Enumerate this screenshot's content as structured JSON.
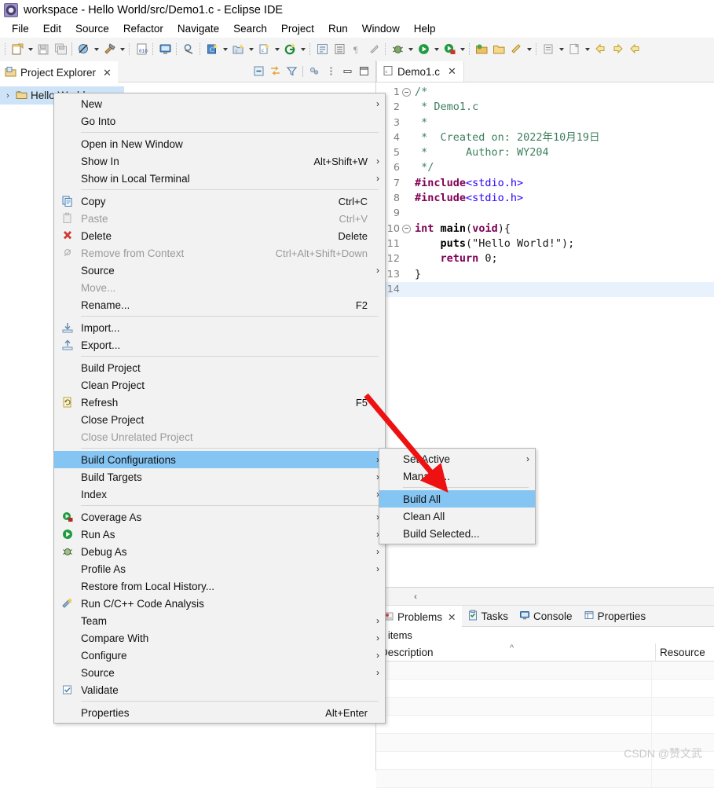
{
  "window": {
    "title": "workspace - Hello World/src/Demo1.c - Eclipse IDE",
    "app_icon": "eclipse-icon"
  },
  "menubar": {
    "items": [
      "File",
      "Edit",
      "Source",
      "Refactor",
      "Navigate",
      "Search",
      "Project",
      "Run",
      "Window",
      "Help"
    ]
  },
  "explorer": {
    "tab_label": "Project Explorer",
    "close_label": "✕",
    "tree": [
      {
        "label": "Hello World",
        "twisty": "›",
        "selected": true
      }
    ]
  },
  "editor": {
    "tab_label": "Demo1.c",
    "close_label": "✕",
    "lines": [
      {
        "n": "1",
        "fold": true,
        "text": "/*"
      },
      {
        "n": "2",
        "fold": false,
        "text": " * Demo1.c"
      },
      {
        "n": "3",
        "fold": false,
        "text": " *"
      },
      {
        "n": "4",
        "fold": false,
        "text": " *  Created on: 2022年10月19日"
      },
      {
        "n": "5",
        "fold": false,
        "text": " *      Author: WY204"
      },
      {
        "n": "6",
        "fold": false,
        "text": " */"
      },
      {
        "n": "7",
        "fold": false,
        "text": "#include<stdio.h>"
      },
      {
        "n": "8",
        "fold": false,
        "text": "#include<stdio.h>"
      },
      {
        "n": "9",
        "fold": false,
        "text": ""
      },
      {
        "n": "10",
        "fold": true,
        "text": "int main(void){"
      },
      {
        "n": "11",
        "fold": false,
        "text": "    puts(\"Hello World!\");"
      },
      {
        "n": "12",
        "fold": false,
        "text": "    return 0;"
      },
      {
        "n": "13",
        "fold": false,
        "text": "}"
      },
      {
        "n": "14",
        "fold": false,
        "text": ""
      }
    ]
  },
  "bottom_view": {
    "tabs": [
      {
        "label": "Problems",
        "icon": "problems-icon",
        "active": true,
        "closable": true
      },
      {
        "label": "Tasks",
        "icon": "tasks-icon",
        "active": false,
        "closable": false
      },
      {
        "label": "Console",
        "icon": "console-icon",
        "active": false,
        "closable": false
      },
      {
        "label": "Properties",
        "icon": "properties-icon",
        "active": false,
        "closable": false
      }
    ],
    "item_count": "0 items",
    "columns": [
      "Description",
      "Resource"
    ]
  },
  "context_menu": {
    "items": [
      {
        "label": "New",
        "icon": "",
        "accel": "",
        "arrow": true,
        "disabled": false,
        "highlight": false
      },
      {
        "label": "Go Into",
        "icon": "",
        "accel": "",
        "arrow": false,
        "disabled": false,
        "highlight": false
      },
      {
        "separator": true
      },
      {
        "label": "Open in New Window",
        "icon": "",
        "accel": "",
        "arrow": false,
        "disabled": false,
        "highlight": false
      },
      {
        "label": "Show In",
        "icon": "",
        "accel": "Alt+Shift+W",
        "arrow": true,
        "disabled": false,
        "highlight": false
      },
      {
        "label": "Show in Local Terminal",
        "icon": "",
        "accel": "",
        "arrow": true,
        "disabled": false,
        "highlight": false
      },
      {
        "separator": true
      },
      {
        "label": "Copy",
        "icon": "copy-icon",
        "accel": "Ctrl+C",
        "arrow": false,
        "disabled": false,
        "highlight": false
      },
      {
        "label": "Paste",
        "icon": "paste-icon",
        "accel": "Ctrl+V",
        "arrow": false,
        "disabled": true,
        "highlight": false
      },
      {
        "label": "Delete",
        "icon": "delete-icon",
        "accel": "Delete",
        "arrow": false,
        "disabled": false,
        "highlight": false
      },
      {
        "label": "Remove from Context",
        "icon": "remove-icon",
        "accel": "Ctrl+Alt+Shift+Down",
        "arrow": false,
        "disabled": true,
        "highlight": false
      },
      {
        "label": "Source",
        "icon": "",
        "accel": "",
        "arrow": true,
        "disabled": false,
        "highlight": false
      },
      {
        "label": "Move...",
        "icon": "",
        "accel": "",
        "arrow": false,
        "disabled": true,
        "highlight": false
      },
      {
        "label": "Rename...",
        "icon": "",
        "accel": "F2",
        "arrow": false,
        "disabled": false,
        "highlight": false
      },
      {
        "separator": true
      },
      {
        "label": "Import...",
        "icon": "import-icon",
        "accel": "",
        "arrow": false,
        "disabled": false,
        "highlight": false
      },
      {
        "label": "Export...",
        "icon": "export-icon",
        "accel": "",
        "arrow": false,
        "disabled": false,
        "highlight": false
      },
      {
        "separator": true
      },
      {
        "label": "Build Project",
        "icon": "",
        "accel": "",
        "arrow": false,
        "disabled": false,
        "highlight": false
      },
      {
        "label": "Clean Project",
        "icon": "",
        "accel": "",
        "arrow": false,
        "disabled": false,
        "highlight": false
      },
      {
        "label": "Refresh",
        "icon": "refresh-icon",
        "accel": "F5",
        "arrow": false,
        "disabled": false,
        "highlight": false
      },
      {
        "label": "Close Project",
        "icon": "",
        "accel": "",
        "arrow": false,
        "disabled": false,
        "highlight": false
      },
      {
        "label": "Close Unrelated Project",
        "icon": "",
        "accel": "",
        "arrow": false,
        "disabled": true,
        "highlight": false
      },
      {
        "separator": true
      },
      {
        "label": "Build Configurations",
        "icon": "",
        "accel": "",
        "arrow": true,
        "disabled": false,
        "highlight": true
      },
      {
        "label": "Build Targets",
        "icon": "",
        "accel": "",
        "arrow": true,
        "disabled": false,
        "highlight": false
      },
      {
        "label": "Index",
        "icon": "",
        "accel": "",
        "arrow": true,
        "disabled": false,
        "highlight": false
      },
      {
        "separator": true
      },
      {
        "label": "Coverage As",
        "icon": "coverage-icon",
        "accel": "",
        "arrow": true,
        "disabled": false,
        "highlight": false
      },
      {
        "label": "Run As",
        "icon": "run-icon",
        "accel": "",
        "arrow": true,
        "disabled": false,
        "highlight": false
      },
      {
        "label": "Debug As",
        "icon": "debug-icon",
        "accel": "",
        "arrow": true,
        "disabled": false,
        "highlight": false
      },
      {
        "label": "Profile As",
        "icon": "",
        "accel": "",
        "arrow": true,
        "disabled": false,
        "highlight": false
      },
      {
        "label": "Restore from Local History...",
        "icon": "",
        "accel": "",
        "arrow": false,
        "disabled": false,
        "highlight": false
      },
      {
        "label": "Run C/C++ Code Analysis",
        "icon": "analysis-icon",
        "accel": "",
        "arrow": false,
        "disabled": false,
        "highlight": false
      },
      {
        "label": "Team",
        "icon": "",
        "accel": "",
        "arrow": true,
        "disabled": false,
        "highlight": false
      },
      {
        "label": "Compare With",
        "icon": "",
        "accel": "",
        "arrow": true,
        "disabled": false,
        "highlight": false
      },
      {
        "label": "Configure",
        "icon": "",
        "accel": "",
        "arrow": true,
        "disabled": false,
        "highlight": false
      },
      {
        "label": "Source",
        "icon": "",
        "accel": "",
        "arrow": true,
        "disabled": false,
        "highlight": false
      },
      {
        "label": "Validate",
        "icon": "checkbox-icon",
        "accel": "",
        "arrow": false,
        "disabled": false,
        "highlight": false
      },
      {
        "separator": true
      },
      {
        "label": "Properties",
        "icon": "",
        "accel": "Alt+Enter",
        "arrow": false,
        "disabled": false,
        "highlight": false
      }
    ]
  },
  "submenu": {
    "items": [
      {
        "label": "Set Active",
        "arrow": true,
        "highlight": false
      },
      {
        "label": "Manage...",
        "arrow": false,
        "highlight": false
      },
      {
        "separator": true
      },
      {
        "label": "Build All",
        "arrow": false,
        "highlight": true
      },
      {
        "label": "Clean All",
        "arrow": false,
        "highlight": false
      },
      {
        "label": "Build Selected...",
        "arrow": false,
        "highlight": false
      }
    ]
  },
  "annotation": {
    "arrow_color": "#ee1111"
  },
  "watermark": {
    "text": "CSDN @赞文武"
  },
  "colors": {
    "highlight": "#84c5f4",
    "selection": "#cde3f7",
    "toolbar_bg": "#f4f4f4",
    "menu_bg": "#f2f2f2"
  }
}
